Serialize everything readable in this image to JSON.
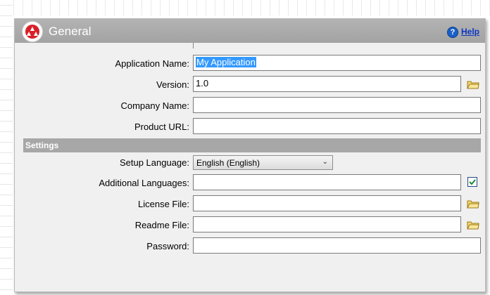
{
  "header": {
    "title": "General",
    "help_label": "Help",
    "help_icon": "?"
  },
  "form": {
    "application_name": {
      "label": "Application Name:",
      "value": "My Application"
    },
    "version": {
      "label": "Version:",
      "value": "1.0"
    },
    "company_name": {
      "label": "Company Name:",
      "value": ""
    },
    "product_url": {
      "label": "Product URL:",
      "value": ""
    }
  },
  "settings": {
    "section_title": "Settings",
    "setup_language": {
      "label": "Setup Language:",
      "value": "English (English)"
    },
    "additional_languages": {
      "label": "Additional Languages:",
      "value": ""
    },
    "license_file": {
      "label": "License File:",
      "value": ""
    },
    "readme_file": {
      "label": "Readme File:",
      "value": ""
    },
    "password": {
      "label": "Password:",
      "value": ""
    }
  },
  "colors": {
    "header_bg": "#a9a9a9",
    "section_bg": "#a7a7a7",
    "selection": "#3399ff",
    "link": "#0b36c4",
    "logo_red": "#d8202a"
  }
}
